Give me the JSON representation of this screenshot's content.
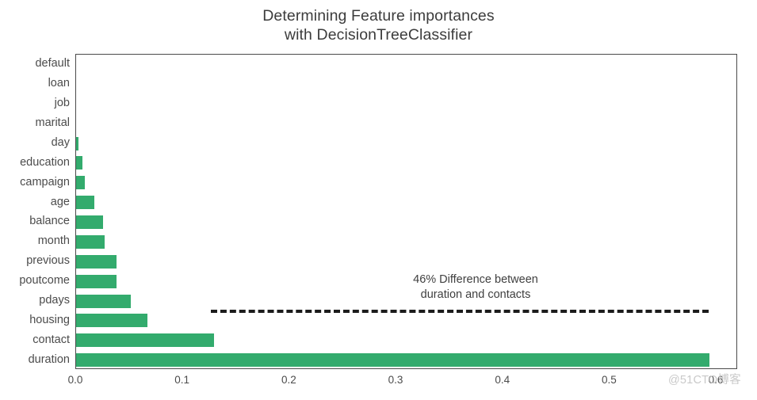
{
  "title": "Determining Feature importances\nwith DecisionTreeClassifier",
  "annotation": "46% Difference between\nduration and contacts",
  "watermark": "@51CTO博客",
  "colors": {
    "bar": "#33ab6d",
    "axis": "#4a4a4a",
    "text": "#4b4b4b",
    "dashed_line": "#1c1c1c",
    "watermark": "#c9c9c9"
  },
  "chart_data": {
    "type": "bar",
    "orientation": "horizontal",
    "title": "Determining Feature importances with DecisionTreeClassifier",
    "xlabel": "",
    "ylabel": "",
    "xlim": [
      0.0,
      0.62
    ],
    "ylim": [
      0,
      16
    ],
    "grid": false,
    "legend": null,
    "xticks": [
      "0.0",
      "0.1",
      "0.2",
      "0.3",
      "0.4",
      "0.5",
      "0.6"
    ],
    "xtick_values": [
      0.0,
      0.1,
      0.2,
      0.3,
      0.4,
      0.5,
      0.6
    ],
    "categories": [
      "default",
      "loan",
      "job",
      "marital",
      "day",
      "education",
      "campaign",
      "age",
      "balance",
      "month",
      "previous",
      "poutcome",
      "pdays",
      "housing",
      "contact",
      "duration"
    ],
    "values": [
      0.0,
      0.0,
      0.0,
      0.0,
      0.002,
      0.006,
      0.008,
      0.017,
      0.025,
      0.027,
      0.038,
      0.038,
      0.051,
      0.067,
      0.129,
      0.593
    ],
    "annotations": [
      {
        "text": "46% Difference between\nduration and contacts",
        "x": 0.38,
        "y": 12.5
      },
      {
        "type": "dashed-line",
        "x_start": 0.127,
        "x_end": 0.593,
        "y": 2.5
      }
    ]
  }
}
